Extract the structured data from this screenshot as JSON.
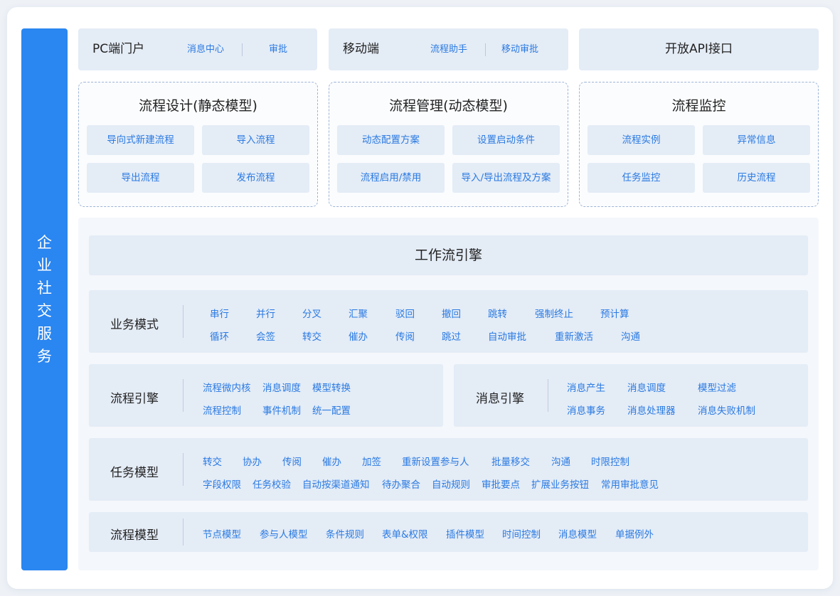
{
  "sidebar": {
    "title": "企业社交服务"
  },
  "top": {
    "pc": {
      "title": "PC端门户",
      "links": [
        "消息中心",
        "审批"
      ]
    },
    "mobile": {
      "title": "移动端",
      "links": [
        "流程助手",
        "移动审批"
      ]
    },
    "api": {
      "title": "开放API接口"
    }
  },
  "panels": [
    {
      "title": "流程设计(静态模型)",
      "buttons": [
        "导向式新建流程",
        "导入流程",
        "导出流程",
        "发布流程"
      ]
    },
    {
      "title": "流程管理(动态模型)",
      "buttons": [
        "动态配置方案",
        "设置启动条件",
        "流程启用/禁用",
        "导入/导出流程及方案"
      ]
    },
    {
      "title": "流程监控",
      "buttons": [
        "流程实例",
        "异常信息",
        "任务监控",
        "历史流程"
      ]
    }
  ],
  "engine": {
    "title": "工作流引擎",
    "business": {
      "label": "业务模式",
      "row1": [
        "串行",
        "并行",
        "分叉",
        "汇聚",
        "驳回",
        "撤回",
        "跳转",
        "强制终止",
        "预计算"
      ],
      "row2": [
        "循环",
        "会签",
        "转交",
        "催办",
        "传阅",
        "跳过",
        "自动审批",
        "重新激活",
        "沟通"
      ]
    },
    "flow_engine": {
      "label": "流程引擎",
      "row1": [
        "流程微内核",
        "消息调度",
        "模型转换"
      ],
      "row2": [
        "流程控制",
        "事件机制",
        "统一配置"
      ]
    },
    "message_engine": {
      "label": "消息引擎",
      "row1": [
        "消息产生",
        "消息调度",
        "模型过滤"
      ],
      "row2": [
        "消息事务",
        "消息处理器",
        "消息失败机制"
      ]
    },
    "task_model": {
      "label": "任务模型",
      "row1": [
        "转交",
        "协办",
        "传阅",
        "催办",
        "加签",
        "重新设置参与人",
        "批量移交",
        "沟通",
        "时限控制"
      ],
      "row2": [
        "字段权限",
        "任务校验",
        "自动按渠道通知",
        "待办聚合",
        "自动规则",
        "审批要点",
        "扩展业务按钮",
        "常用审批意见"
      ]
    },
    "flow_model": {
      "label": "流程模型",
      "row1": [
        "节点模型",
        "参与人模型",
        "条件规则",
        "表单&权限",
        "插件模型",
        "时间控制",
        "消息模型",
        "单据例外"
      ]
    }
  },
  "colors": {
    "accent": "#2a86f0",
    "link": "#2a7ae2",
    "box": "#e4ecf6",
    "border": "#9db4d6"
  }
}
